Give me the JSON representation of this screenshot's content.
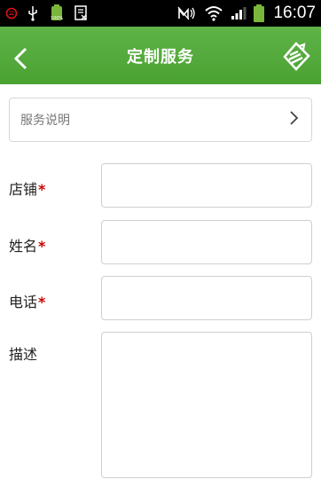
{
  "status_bar": {
    "time": "16:07",
    "icons": [
      "notification-icon",
      "usb-icon",
      "battery-full-app-icon",
      "document-icon",
      "silent-mode-icon",
      "wifi-icon",
      "signal-icon",
      "battery-icon"
    ]
  },
  "app_bar": {
    "title": "定制服务",
    "back_icon": "back-arrow-icon",
    "action_icon": "custom-logo-icon",
    "color": "#4aa231"
  },
  "info": {
    "label": "服务说明",
    "chevron_icon": "chevron-right-icon"
  },
  "form": {
    "fields": [
      {
        "label": "店铺",
        "required_mark": "*",
        "value": ""
      },
      {
        "label": "姓名",
        "required_mark": "*",
        "value": ""
      },
      {
        "label": "电话",
        "required_mark": "*",
        "value": ""
      },
      {
        "label": "描述",
        "required_mark": "",
        "value": ""
      }
    ]
  },
  "colors": {
    "status_bar": "#000000",
    "app_bar": "#4aa231",
    "required": "#cc0000"
  }
}
